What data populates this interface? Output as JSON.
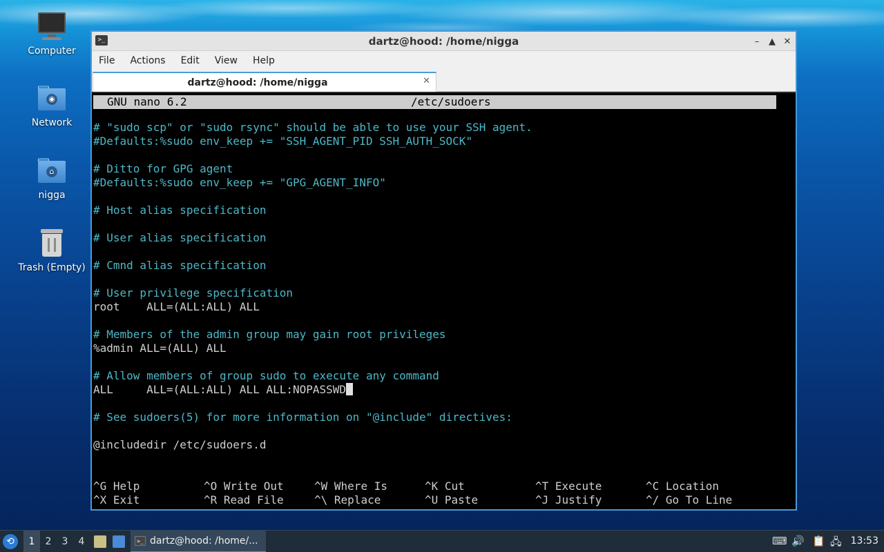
{
  "desktop": {
    "icons": [
      {
        "label": "Computer",
        "icon": "computer-icon"
      },
      {
        "label": "Network",
        "icon": "network-folder-icon"
      },
      {
        "label": "nigga",
        "icon": "home-folder-icon"
      },
      {
        "label": "Trash (Empty)",
        "icon": "trash-icon"
      }
    ]
  },
  "window": {
    "title": "dartz@hood: /home/nigga",
    "controls": {
      "minimize": "–",
      "maximize": "▲",
      "close": "✕"
    },
    "menu": [
      "File",
      "Actions",
      "Edit",
      "View",
      "Help"
    ],
    "tab": {
      "label": "dartz@hood: /home/nigga",
      "close": "✕"
    }
  },
  "nano": {
    "version": "GNU nano 6.2",
    "filename": "/etc/sudoers",
    "lines": [
      {
        "text": "# \"sudo scp\" or \"sudo rsync\" should be able to use your SSH agent.",
        "kind": "comment"
      },
      {
        "text": "#Defaults:%sudo env_keep += \"SSH_AGENT_PID SSH_AUTH_SOCK\"",
        "kind": "comment"
      },
      {
        "text": "",
        "kind": "normal"
      },
      {
        "text": "# Ditto for GPG agent",
        "kind": "comment"
      },
      {
        "text": "#Defaults:%sudo env_keep += \"GPG_AGENT_INFO\"",
        "kind": "comment"
      },
      {
        "text": "",
        "kind": "normal"
      },
      {
        "text": "# Host alias specification",
        "kind": "comment"
      },
      {
        "text": "",
        "kind": "normal"
      },
      {
        "text": "# User alias specification",
        "kind": "comment"
      },
      {
        "text": "",
        "kind": "normal"
      },
      {
        "text": "# Cmnd alias specification",
        "kind": "comment"
      },
      {
        "text": "",
        "kind": "normal"
      },
      {
        "text": "# User privilege specification",
        "kind": "comment"
      },
      {
        "text": "root    ALL=(ALL:ALL) ALL",
        "kind": "normal"
      },
      {
        "text": "",
        "kind": "normal"
      },
      {
        "text": "# Members of the admin group may gain root privileges",
        "kind": "comment"
      },
      {
        "text": "%admin ALL=(ALL) ALL",
        "kind": "normal"
      },
      {
        "text": "",
        "kind": "normal"
      },
      {
        "text": "# Allow members of group sudo to execute any command",
        "kind": "comment"
      },
      {
        "text": "ALL     ALL=(ALL:ALL) ALL ALL:NOPASSWD",
        "kind": "normal",
        "cursor": true
      },
      {
        "text": "",
        "kind": "normal"
      },
      {
        "text": "# See sudoers(5) for more information on \"@include\" directives:",
        "kind": "comment"
      },
      {
        "text": "",
        "kind": "normal"
      },
      {
        "text": "@includedir /etc/sudoers.d",
        "kind": "normal"
      }
    ],
    "shortcuts": [
      {
        "key": "^G",
        "label": "Help"
      },
      {
        "key": "^O",
        "label": "Write Out"
      },
      {
        "key": "^W",
        "label": "Where Is"
      },
      {
        "key": "^K",
        "label": "Cut"
      },
      {
        "key": "^T",
        "label": "Execute"
      },
      {
        "key": "^C",
        "label": "Location"
      },
      {
        "key": "^X",
        "label": "Exit"
      },
      {
        "key": "^R",
        "label": "Read File"
      },
      {
        "key": "^\\",
        "label": "Replace"
      },
      {
        "key": "^U",
        "label": "Paste"
      },
      {
        "key": "^J",
        "label": "Justify"
      },
      {
        "key": "^/",
        "label": "Go To Line"
      }
    ]
  },
  "taskbar": {
    "workspaces": [
      "1",
      "2",
      "3",
      "4"
    ],
    "active_workspace": "1",
    "task_label": "dartz@hood: /home/...",
    "clock": "13:53"
  },
  "colors": {
    "accent": "#4a9bd8",
    "comment": "#4cb8c8",
    "terminal_bg": "#000000"
  }
}
